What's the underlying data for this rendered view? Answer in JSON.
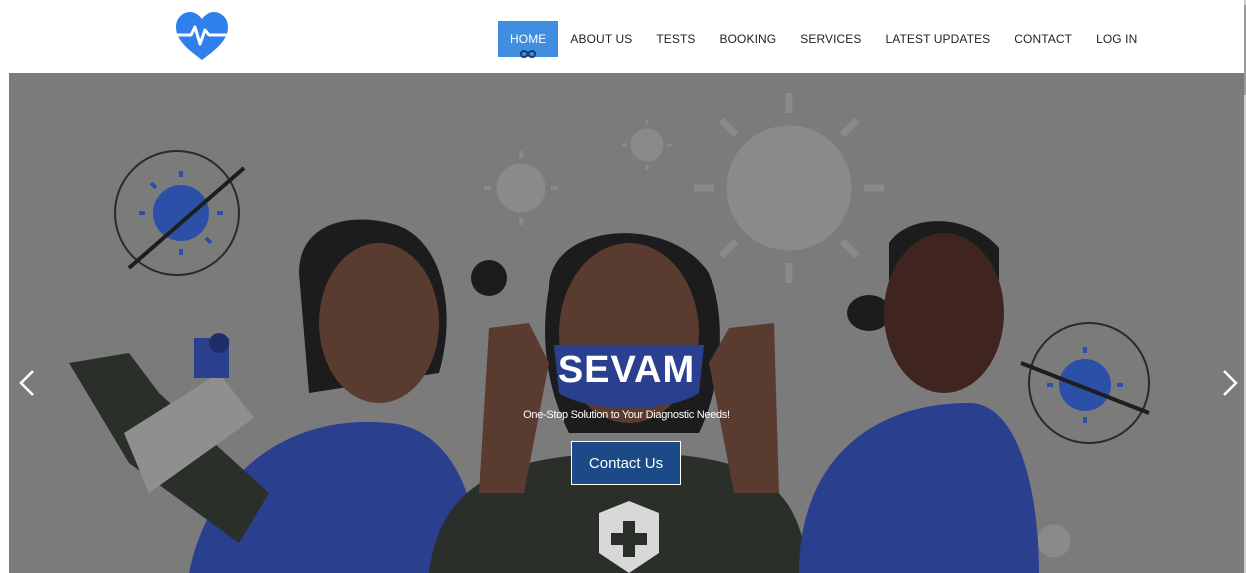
{
  "brand": {
    "logo_icon": "heart-pulse-icon",
    "color": "#2f80ed"
  },
  "nav": {
    "items": [
      {
        "label": "HOME",
        "active": true
      },
      {
        "label": "ABOUT US"
      },
      {
        "label": "TESTS"
      },
      {
        "label": "BOOKING"
      },
      {
        "label": "SERVICES"
      },
      {
        "label": "LATEST UPDATES"
      },
      {
        "label": "CONTACT"
      },
      {
        "label": "LOG IN"
      }
    ],
    "active_color": "#3f8ee0"
  },
  "hero": {
    "title": "SEVAM",
    "subtitle": "One-Stop Solution to Your Diagnostic Needs!",
    "cta_label": "Contact Us",
    "cta_color": "#1b4a86",
    "prev_icon": "chevron-left-icon",
    "next_icon": "chevron-right-icon"
  }
}
